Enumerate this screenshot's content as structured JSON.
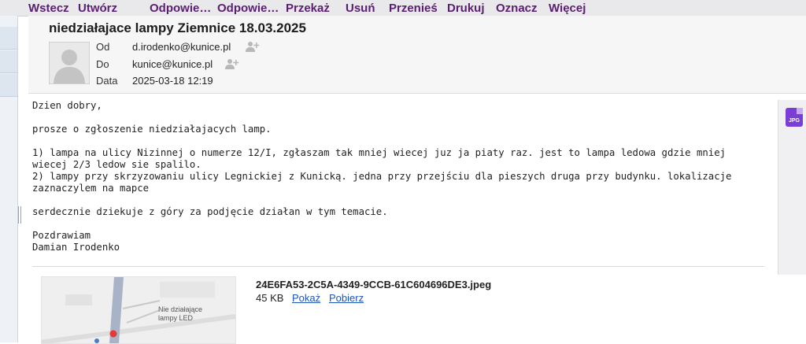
{
  "toolbar": {
    "back": "Wstecz",
    "compose": "Utwórz",
    "reply": "Odpowie…",
    "reply_all": "Odpowie…",
    "forward": "Przekaż",
    "delete": "Usuń",
    "move": "Przenieś",
    "print": "Drukuj",
    "mark": "Oznacz",
    "more": "Więcej"
  },
  "header": {
    "subject": "niedziałajace lampy Ziemnice 18.03.2025",
    "from_label": "Od",
    "from": "d.irodenko@kunice.pl",
    "to_label": "Do",
    "to": "kunice@kunice.pl",
    "date_label": "Data",
    "date": "2025-03-18 12:19"
  },
  "body": {
    "text": "Dzien dobry,\n\nprosze o zgłoszenie niedziałajacych lamp.\n\n1) lampa na ulicy Nizinnej o numerze 12/I, zgłaszam tak mniej wiecej juz ja piaty raz. jest to lampa ledowa gdzie mniej\nwiecej 2/3 ledow sie spalilo.\n2) lampy przy skrzyzowaniu ulicy Legnickiej z Kunicką. jedna przy przejściu dla pieszych druga przy budynku. lokalizacje\nzaznaczylem na mapce\n\nserdecznie dziekuje z góry za podjęcie działan w tym temacie.\n\nPozdrawiam\nDamian Irodenko"
  },
  "attachment_badge": "JPG",
  "attachment": {
    "filename": "24E6FA53-2C5A-4349-9CCB-61C604696DE3.jpeg",
    "size": "45 KB",
    "show_label": "Pokaż",
    "download_label": "Pobierz",
    "map_annotation_line1": "Nie działające",
    "map_annotation_line2": "lampy LED"
  },
  "colors": {
    "toolbar_text": "#5a1f70",
    "link": "#1f54b7",
    "badge": "#7a3dd6",
    "marker": "#e53935"
  }
}
